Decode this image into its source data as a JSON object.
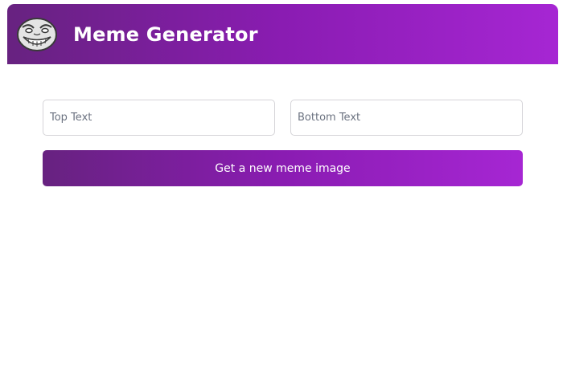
{
  "header": {
    "title": "Meme Generator",
    "logo_icon": "troll-face-icon",
    "gradient": [
      "#672280",
      "#a626d3"
    ]
  },
  "form": {
    "top_text": {
      "value": "",
      "placeholder": "Top Text"
    },
    "bottom_text": {
      "value": "",
      "placeholder": "Bottom Text"
    },
    "submit_label": "Get a new meme image"
  }
}
